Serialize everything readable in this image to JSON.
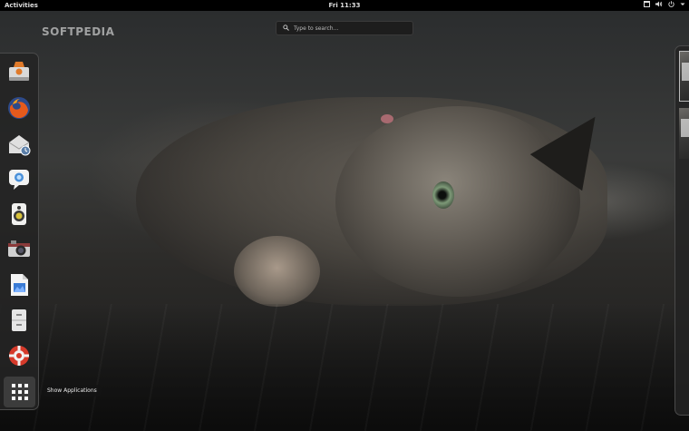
{
  "topbar": {
    "activities_label": "Activities",
    "clock": "Fri 11:33"
  },
  "status_icons": [
    "window-icon",
    "volume-icon",
    "power-icon",
    "dropdown-arrow-icon"
  ],
  "watermark": "SOFTPEDIA",
  "search": {
    "placeholder": "Type to search..."
  },
  "dash": {
    "items": [
      {
        "name": "software-center-icon",
        "color": "#e07a2a"
      },
      {
        "name": "firefox-icon",
        "color": "#e55a1c"
      },
      {
        "name": "mail-client-icon",
        "color": "#dcdcdc"
      },
      {
        "name": "messaging-icon",
        "color": "#4a90d9"
      },
      {
        "name": "music-player-icon",
        "color": "#d8c23a"
      },
      {
        "name": "camera-icon",
        "color": "#555555"
      },
      {
        "name": "image-viewer-icon",
        "color": "#3a7bd5"
      },
      {
        "name": "file-manager-icon",
        "color": "#cfcfcf"
      },
      {
        "name": "help-icon",
        "color": "#d63a2a"
      },
      {
        "name": "show-applications-icon",
        "color": "#ffffff"
      }
    ],
    "tooltip": "Show Applications"
  },
  "workspaces": {
    "count": 2,
    "active_index": 0
  }
}
